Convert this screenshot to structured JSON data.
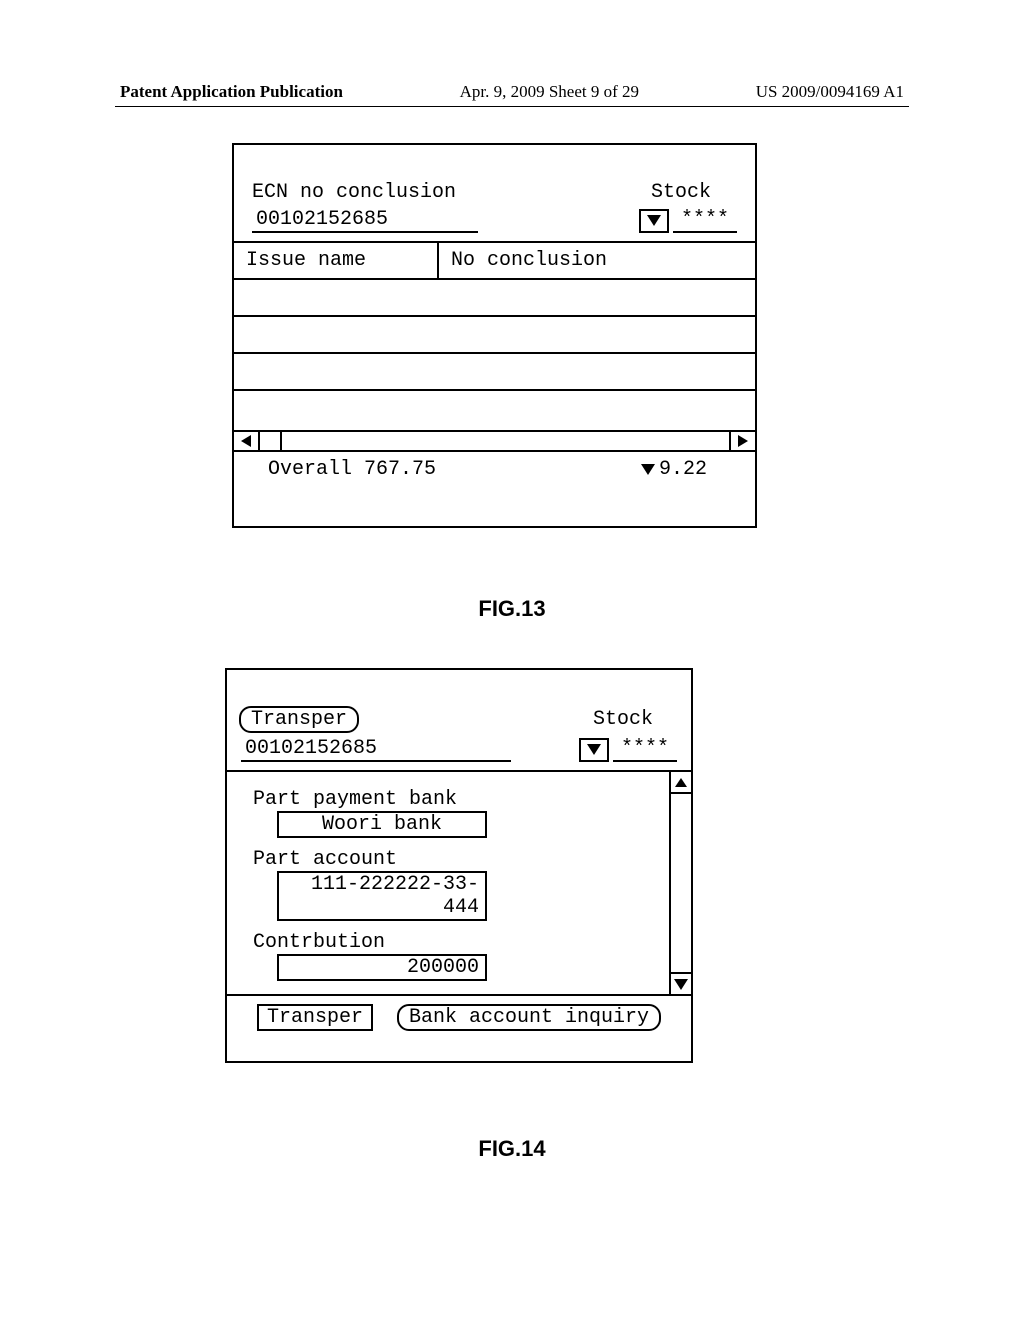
{
  "header": {
    "left": "Patent Application Publication",
    "center": "Apr. 9, 2009  Sheet 9 of 29",
    "right": "US 2009/0094169 A1"
  },
  "fig13": {
    "ecn_label": "ECN no conclusion",
    "stock_label": "Stock",
    "account": "00102152685",
    "stars": "****",
    "col_issue": "Issue name",
    "col_noconc": "No conclusion",
    "overall_label": "Overall",
    "overall_value": "767.75",
    "change_value": "9.22",
    "caption": "FIG.13"
  },
  "fig14": {
    "transper_btn": "Transper",
    "stock_label": "Stock",
    "account": "00102152685",
    "stars": "****",
    "bank_label": "Part payment bank",
    "bank_value": "Woori bank",
    "acct_label": "Part account",
    "acct_value": "111-222222-33-444",
    "contrib_label": "Contrbution",
    "contrib_value": "200000",
    "btn_transper": "Transper",
    "btn_inquiry": "Bank account inquiry",
    "caption": "FIG.14"
  }
}
